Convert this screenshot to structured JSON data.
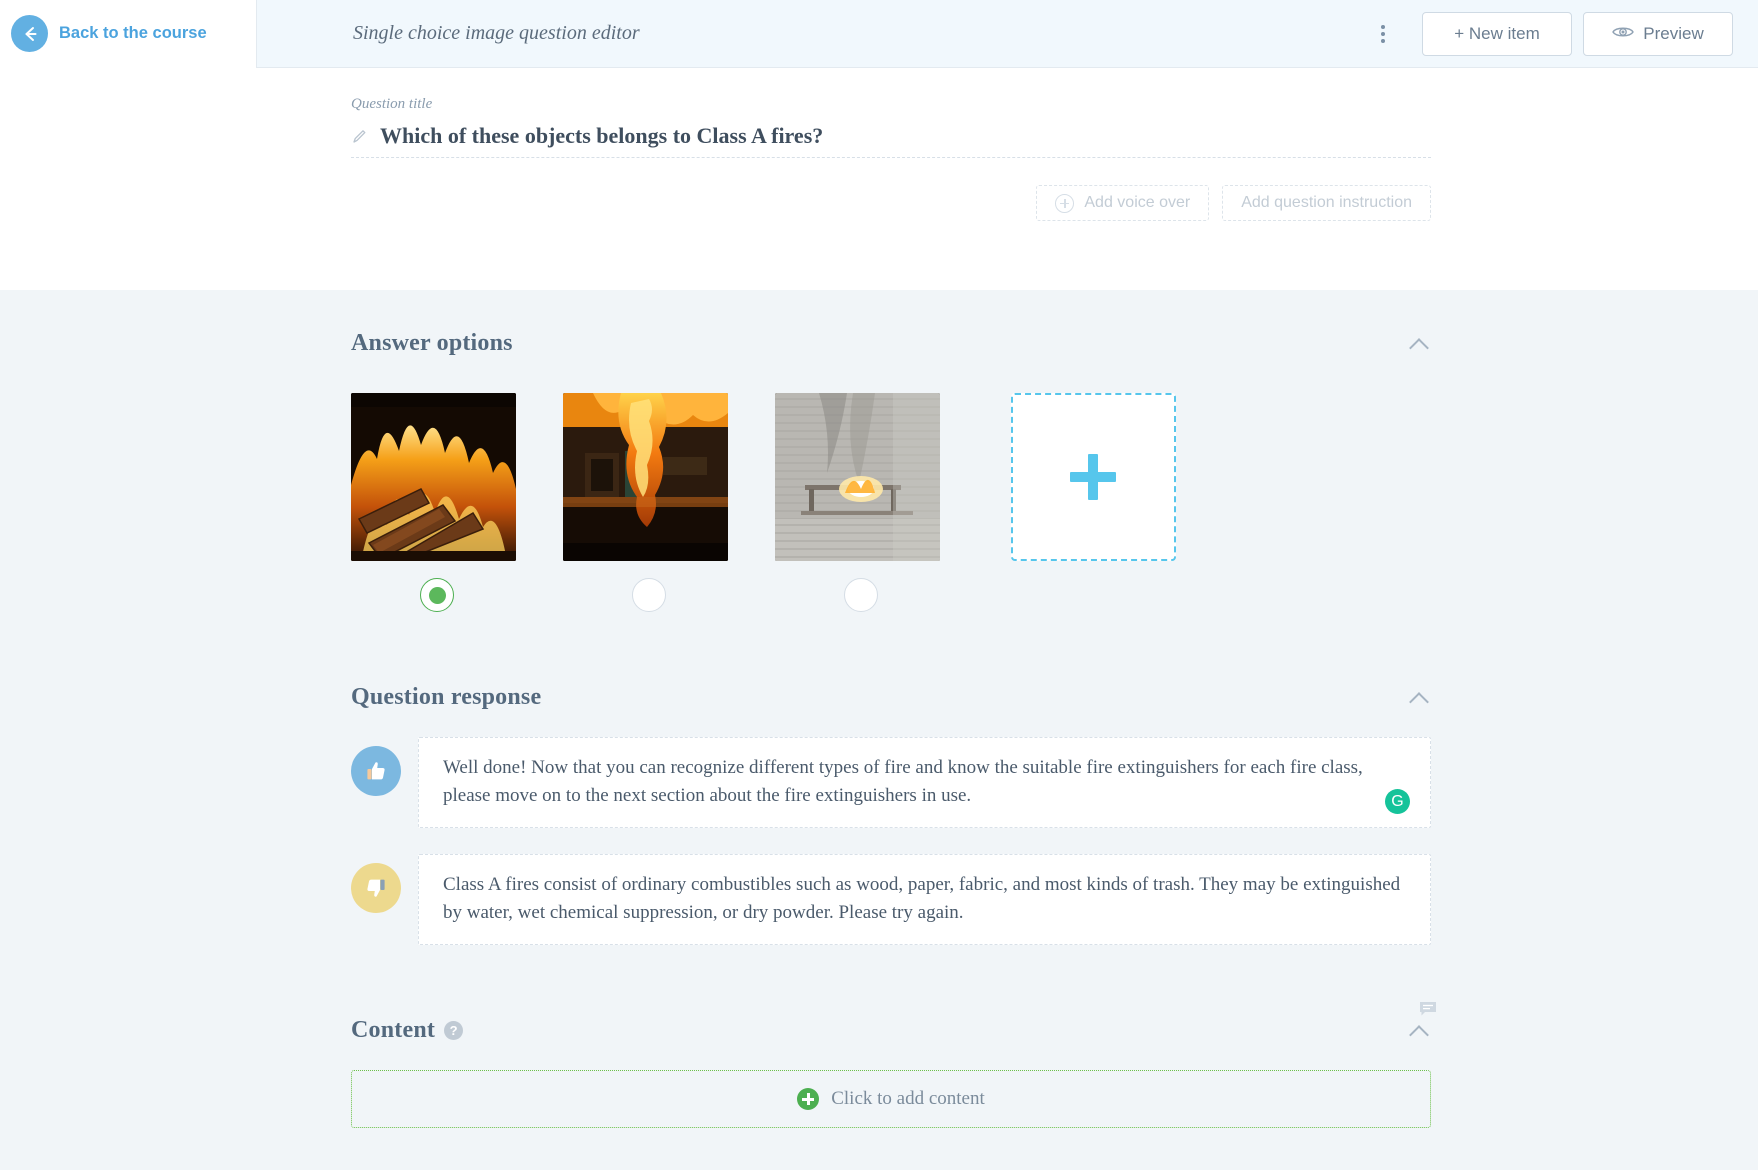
{
  "header": {
    "back_label": "Back to the course",
    "back_icon": "arrow-left-icon",
    "title": "Single choice image question editor",
    "kebab_icon": "more-vertical-icon",
    "new_item_label": "+ New item",
    "preview_label": "Preview",
    "preview_icon": "eye-icon"
  },
  "question": {
    "title_label": "Question title",
    "edit_icon": "pencil-icon",
    "title_text": "Which of these objects belongs to Class A fires?",
    "add_voice_over_label": "Add voice over",
    "add_voice_over_icon": "plus-circle-icon",
    "add_instruction_label": "Add question instruction"
  },
  "answer_options": {
    "title": "Answer options",
    "collapse_icon": "chevron-up-icon",
    "options": [
      {
        "name": "fireplace-logs-image",
        "selected": true
      },
      {
        "name": "room-fire-image",
        "selected": false
      },
      {
        "name": "outdoor-fire-image",
        "selected": false
      }
    ],
    "add_option_icon": "plus-icon"
  },
  "question_response": {
    "title": "Question response",
    "collapse_icon": "chevron-up-icon",
    "correct": {
      "icon": "thumbs-up-icon",
      "text": "Well done! Now that you can recognize different types of fire and know the suitable fire extinguishers for each fire class, please move on to the next section about the fire extinguishers in use.",
      "badge_icon": "grammarly-icon",
      "badge_glyph": "G"
    },
    "incorrect": {
      "icon": "thumbs-down-icon",
      "text": "Class A fires consist of ordinary combustibles such as wood, paper, fabric, and most kinds of trash. They may be extinguished by water, wet chemical suppression, or dry powder. Please try again."
    }
  },
  "content_section": {
    "title": "Content",
    "help_glyph": "?",
    "help_icon": "question-mark-icon",
    "comment_icon": "comment-icon",
    "collapse_icon": "chevron-up-icon",
    "add_content_label": "Click to add content",
    "add_content_icon": "plus-circle-green-icon"
  },
  "colors": {
    "accent_blue": "#4ba3de",
    "cyan_dashed": "#56c6ec",
    "green_selected": "#5cb85c",
    "green_add": "#4caf50",
    "grammarly_green": "#15c39a",
    "header_bg": "#f1f8fd",
    "body_bg": "#f1f5f8"
  }
}
